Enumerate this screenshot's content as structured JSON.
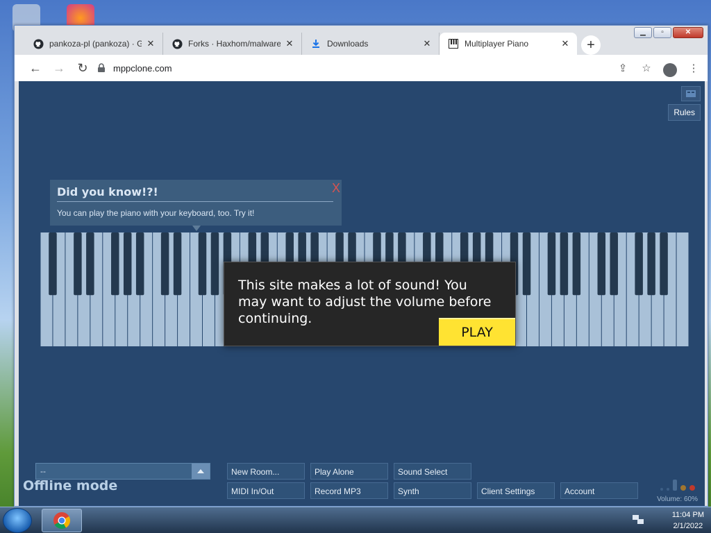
{
  "tabs": [
    {
      "title": "pankoza-pl (pankoza) · Gi",
      "icon": "github-icon",
      "active": false
    },
    {
      "title": "Forks · Haxhom/malware",
      "icon": "github-icon",
      "active": false
    },
    {
      "title": "Downloads",
      "icon": "download-icon",
      "active": false
    },
    {
      "title": "Multiplayer Piano",
      "icon": "piano-icon",
      "active": true
    }
  ],
  "address": {
    "url": "mppclone.com"
  },
  "page": {
    "rules_label": "Rules",
    "tip": {
      "title": "Did you know!?!",
      "body": "You can play the piano with your keyboard, too. Try it!",
      "close": "X"
    },
    "modal": {
      "text": "This site makes a lot of sound! You may want to adjust the volume before continuing.",
      "play_label": "PLAY"
    },
    "room_select_value": "--",
    "status": "Offline mode",
    "buttons": {
      "new_room": "New Room...",
      "play_alone": "Play Alone",
      "sound_select": "Sound Select",
      "midi": "MIDI In/Out",
      "record": "Record MP3",
      "synth": "Synth",
      "client_settings": "Client Settings",
      "account": "Account"
    },
    "volume": "Volume: 60%",
    "volume_level": 0.6,
    "colors": {
      "background": "#27476e",
      "play_button": "#ffe332"
    }
  },
  "taskbar": {
    "time": "11:04 PM",
    "date": "2/1/2022"
  }
}
